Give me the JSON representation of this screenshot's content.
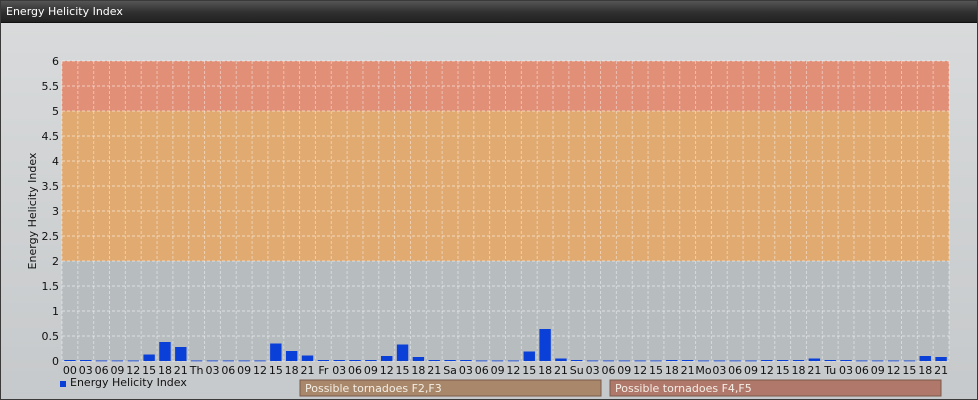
{
  "window": {
    "title": "Energy Helicity Index"
  },
  "chart_data": {
    "type": "bar",
    "ylabel": "Energy Helicity Index",
    "ylim": [
      0,
      6
    ],
    "ytick_labels": [
      "0",
      "0.5",
      "1",
      "1.5",
      "2",
      "2.5",
      "3",
      "3.5",
      "4",
      "4.5",
      "5",
      "5.5",
      "6"
    ],
    "grid": true,
    "bar_color": "#0a3fd8",
    "categories": [
      "00",
      "03",
      "06",
      "09",
      "12",
      "15",
      "18",
      "21",
      "Th",
      "03",
      "06",
      "09",
      "12",
      "15",
      "18",
      "21",
      "Fr",
      "03",
      "06",
      "09",
      "12",
      "15",
      "18",
      "21",
      "Sa",
      "03",
      "06",
      "09",
      "12",
      "15",
      "18",
      "21",
      "Su",
      "03",
      "06",
      "09",
      "12",
      "15",
      "18",
      "21",
      "Mo",
      "03",
      "06",
      "09",
      "12",
      "15",
      "18",
      "21",
      "Tu",
      "03",
      "06",
      "09",
      "12",
      "15",
      "18",
      "21"
    ],
    "series": [
      {
        "name": "Energy Helicity Index",
        "values": [
          0.02,
          0.02,
          0.01,
          0.01,
          0.01,
          0.13,
          0.38,
          0.28,
          0.01,
          0.01,
          0.01,
          0.01,
          0.01,
          0.35,
          0.2,
          0.11,
          0.02,
          0.02,
          0.02,
          0.02,
          0.1,
          0.33,
          0.08,
          0.02,
          0.02,
          0.02,
          0.01,
          0.01,
          0.01,
          0.19,
          0.64,
          0.05,
          0.02,
          0.01,
          0.01,
          0.01,
          0.01,
          0.01,
          0.02,
          0.02,
          0.01,
          0.01,
          0.01,
          0.01,
          0.02,
          0.02,
          0.02,
          0.05,
          0.02,
          0.02,
          0.01,
          0.01,
          0.01,
          0.01,
          0.1,
          0.08
        ]
      }
    ],
    "bands": [
      {
        "from": 2,
        "to": 5,
        "color": "#e6a767",
        "label": "Possible tornadoes F2,F3"
      },
      {
        "from": 5,
        "to": 6,
        "color": "#e58a6f",
        "label": "Possible tornadoes F4,F5"
      }
    ],
    "legend": {
      "placement": "bottom-left",
      "label": "Energy Helicity Index"
    }
  }
}
